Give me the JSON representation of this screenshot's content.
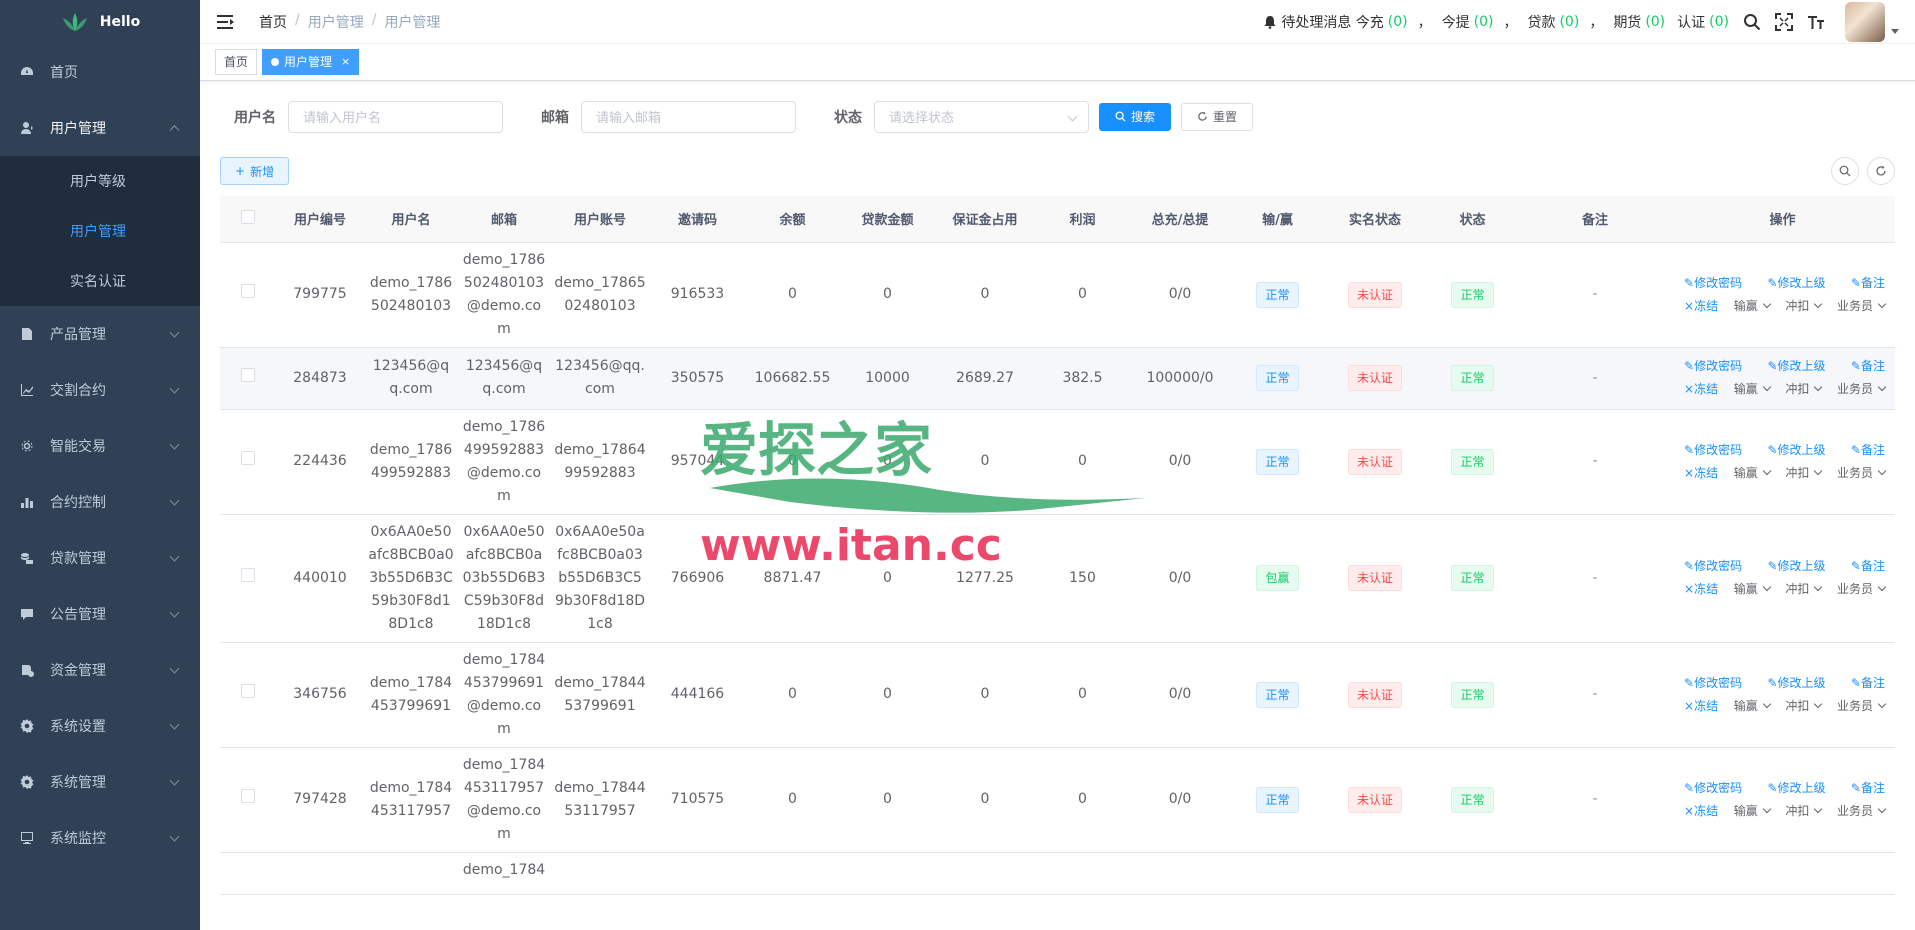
{
  "app": {
    "name": "Hello"
  },
  "sidebar": {
    "items": [
      {
        "label": "首页",
        "icon": "dashboard-icon"
      },
      {
        "label": "用户管理",
        "icon": "user-icon",
        "open": true
      },
      {
        "label": "产品管理",
        "icon": "document-icon"
      },
      {
        "label": "交割合约",
        "icon": "chart-icon"
      },
      {
        "label": "智能交易",
        "icon": "gear-small-icon"
      },
      {
        "label": "合约控制",
        "icon": "bar-chart-icon"
      },
      {
        "label": "贷款管理",
        "icon": "money-icon"
      },
      {
        "label": "公告管理",
        "icon": "message-icon"
      },
      {
        "label": "资金管理",
        "icon": "fund-icon"
      },
      {
        "label": "系统设置",
        "icon": "settings-icon"
      },
      {
        "label": "系统管理",
        "icon": "settings-icon"
      },
      {
        "label": "系统监控",
        "icon": "monitor-icon"
      }
    ],
    "sub_items": [
      "用户等级",
      "用户管理",
      "实名认证"
    ]
  },
  "navbar": {
    "breadcrumb": [
      "首页",
      "用户管理",
      "用户管理"
    ],
    "sep": "/",
    "msg_label": "待处理消息 今充",
    "msg_today_recharge": "(0)",
    "msg_withdraw_label": "今提",
    "msg_withdraw": "(0)",
    "msg_loan_label": "贷款",
    "msg_loan": "(0)",
    "msg_futures_label": "期货",
    "msg_futures": "(0)",
    "msg_auth_label": "认证",
    "msg_auth": "(0)",
    "comma": "，"
  },
  "tags": {
    "home": "首页",
    "active": "用户管理",
    "close": "×"
  },
  "search": {
    "username_label": "用户名",
    "username_placeholder": "请输入用户名",
    "email_label": "邮箱",
    "email_placeholder": "请输入邮箱",
    "status_label": "状态",
    "status_placeholder": "请选择状态",
    "search_btn": "搜索",
    "reset_btn": "重置"
  },
  "toolbar": {
    "add_btn": "新增"
  },
  "table": {
    "columns": [
      "",
      "用户编号",
      "用户名",
      "邮箱",
      "用户账号",
      "邀请码",
      "余额",
      "贷款金额",
      "保证金占用",
      "利润",
      "总充/总提",
      "输/赢",
      "实名状态",
      "状态",
      "备注",
      "操作"
    ],
    "ops": {
      "edit_pwd": "修改密码",
      "edit_parent": "修改上级",
      "remark": "备注",
      "freeze": "冻结",
      "win_lose": "输赢",
      "deduct": "冲扣",
      "agent": "业务员"
    },
    "rows": [
      {
        "id": "799775",
        "username": "demo_17865​02480103",
        "email": "demo_1786​502480103​@demo.co​m",
        "account": "demo_1786​502480103",
        "invite": "916533",
        "balance": "0",
        "loan": "0",
        "margin": "0",
        "profit": "0",
        "total": "0/0",
        "winlose": "正常",
        "winlose_color": "blue",
        "auth": "未认证",
        "status": "正常",
        "remark": "-"
      },
      {
        "id": "284873",
        "username": "123456@qq.​com",
        "email": "123456@q​q.com",
        "account": "123456@q​q.com",
        "invite": "350575",
        "balance": "106682.55",
        "loan": "10000",
        "margin": "2689.27",
        "profit": "382.5",
        "total": "100000/0",
        "winlose": "正常",
        "winlose_color": "blue",
        "auth": "未认证",
        "status": "正常",
        "remark": "-"
      },
      {
        "id": "224436",
        "username": "demo_17864​99592883",
        "email": "demo_1786​499592883​@demo.co​m",
        "account": "demo_1786​499592883",
        "invite": "957044",
        "balance": "0",
        "loan": "0",
        "margin": "0",
        "profit": "0",
        "total": "0/0",
        "winlose": "正常",
        "winlose_color": "blue",
        "auth": "未认证",
        "status": "正常",
        "remark": "-"
      },
      {
        "id": "440010",
        "username": "0x6AA0e50a​fc8BCB0a03​b55D6B3C5​9b30F8d18D​1c8",
        "email": "0x6AA0e50​afc8BCB0a​03b55D6B3​C59b30F8d​18D1c8",
        "account": "0x6AA0e50​afc8BCB0a​03b55D6B3​C59b30F8d​18D1c8",
        "invite": "766906",
        "balance": "8871.47",
        "loan": "0",
        "margin": "1277.25",
        "profit": "150",
        "total": "0/0",
        "winlose": "包赢",
        "winlose_color": "green",
        "auth": "未认证",
        "status": "正常",
        "remark": "-"
      },
      {
        "id": "346756",
        "username": "demo_17844​53799691",
        "email": "demo_1784​453799691​@demo.co​m",
        "account": "demo_1784​453799691",
        "invite": "444166",
        "balance": "0",
        "loan": "0",
        "margin": "0",
        "profit": "0",
        "total": "0/0",
        "winlose": "正常",
        "winlose_color": "blue",
        "auth": "未认证",
        "status": "正常",
        "remark": "-"
      },
      {
        "id": "797428",
        "username": "demo_17844​53117957",
        "email": "demo_1784​453117957​@demo.co​m",
        "account": "demo_1784​453117957",
        "invite": "710575",
        "balance": "0",
        "loan": "0",
        "margin": "0",
        "profit": "0",
        "total": "0/0",
        "winlose": "正常",
        "winlose_color": "blue",
        "auth": "未认证",
        "status": "正常",
        "remark": "-"
      },
      {
        "id": "",
        "username": "",
        "email": "demo_1784",
        "account": "",
        "invite": "",
        "balance": "",
        "loan": "",
        "margin": "",
        "profit": "",
        "total": "",
        "winlose": "",
        "winlose_color": "",
        "auth": "",
        "status": "",
        "remark": "",
        "partial": true
      }
    ]
  },
  "watermark": {
    "line1": "爱探之家",
    "line2": "www.itan.cc"
  }
}
